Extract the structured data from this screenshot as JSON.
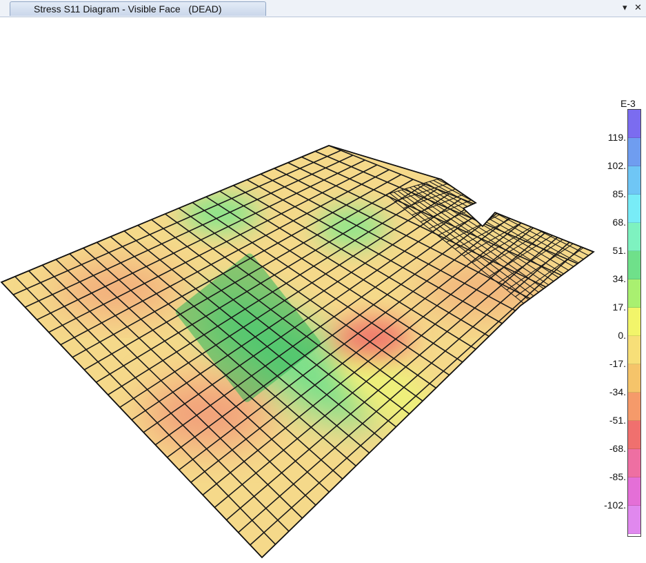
{
  "window": {
    "tab_title": "Stress S11 Diagram - Visible Face   (DEAD)",
    "dropdown_icon": "chevron-down-icon",
    "close_icon": "close-icon"
  },
  "legend": {
    "title": "E-3",
    "ticks": [
      "119.",
      "102.",
      "85.",
      "68.",
      "51.",
      "34.",
      "17.",
      "0.",
      "-17.",
      "-34.",
      "-51.",
      "-68.",
      "-85.",
      "-102."
    ],
    "colors": [
      "#7b6cf0",
      "#6f9df0",
      "#6fc6f5",
      "#78ecf7",
      "#7ef2c0",
      "#6fe08a",
      "#a9f070",
      "#f2f56a",
      "#f7df78",
      "#f5c46a",
      "#f59a6a",
      "#f0706e",
      "#ee6fa2",
      "#e46fd7",
      "#e088ee"
    ]
  }
}
